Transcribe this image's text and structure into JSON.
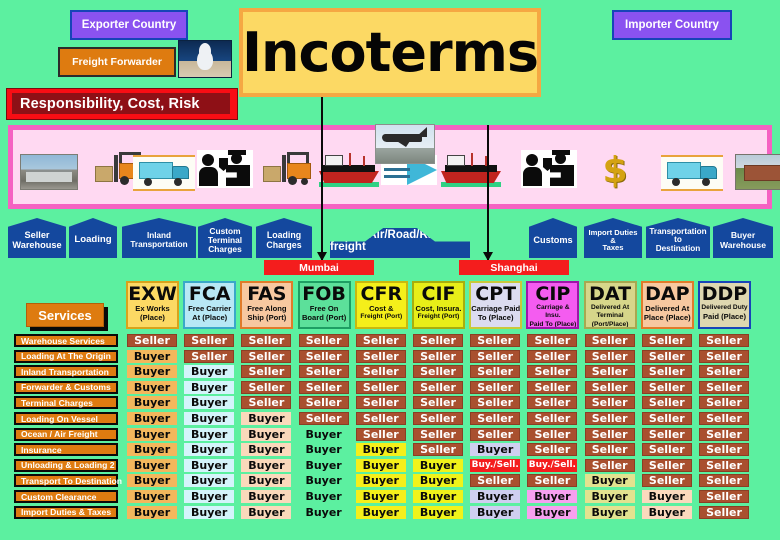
{
  "title": "Incoterms",
  "labels": {
    "exporter_country": "Exporter Country",
    "importer_country": "Importer Country",
    "freight_forwarder": "Freight Forwarder",
    "responsibility": "Responsibility, Cost, Risk",
    "services_title": "Services",
    "freight_band": "Ocean/Air/Road/Rail freight"
  },
  "ports": [
    {
      "name": "Mumbai"
    },
    {
      "name": "Shanghai"
    }
  ],
  "stages": [
    {
      "label": "Seller Warehouse",
      "lines": [
        "Seller",
        "Warehouse"
      ]
    },
    {
      "label": "Loading",
      "lines": [
        "Loading"
      ]
    },
    {
      "label": "Inland Transportation",
      "lines": [
        "Inland",
        "Transportation"
      ]
    },
    {
      "label": "Custom Terminal Charges",
      "lines": [
        "Custom",
        "Terminal",
        "Charges"
      ]
    },
    {
      "label": "Loading Charges",
      "lines": [
        "Loading",
        "Charges"
      ]
    },
    {
      "label": "Customs",
      "lines": [
        "Customs"
      ]
    },
    {
      "label": "Import Duties & Taxes",
      "lines": [
        "Import Duties",
        "&",
        "Taxes"
      ]
    },
    {
      "label": "Transportation to Destination",
      "lines": [
        "Transportation",
        "to",
        "Destination"
      ]
    },
    {
      "label": "Buyer Warehouse",
      "lines": [
        "Buyer",
        "Warehouse"
      ]
    }
  ],
  "icons": [
    "warehouse-photo-icon",
    "forklift-icon",
    "container-truck-icon",
    "customs-officer-icon",
    "forklift-icon",
    "cargo-ship-icon",
    "freight-arrows-icon",
    "airplane-icon",
    "cargo-ship-icon",
    "customs-officer-icon",
    "dollar-sign-icon",
    "container-truck-icon",
    "buyer-warehouse-photo-icon"
  ],
  "services": [
    "Warehouse Services",
    "Loading At The Origin",
    "Inland Transportation",
    "Forwarder & Customs",
    "Terminal Charges",
    "Loading On Vessel",
    "Ocean / Air Freight",
    "Insurance",
    "Unloading & Loading 2",
    "Transport To Destination",
    "Custom Clearance",
    "Import Duties & Taxes"
  ],
  "terms": [
    {
      "code": "EXW",
      "sub": [
        "Ex Works",
        "(Place)"
      ],
      "bg": "#fcd964",
      "border": "#d8a31c",
      "cell_bg": "#f3b75c"
    },
    {
      "code": "FCA",
      "sub": [
        "Free Carrier",
        "At (Place)"
      ],
      "bg": "#b8e8f5",
      "border": "#3aa8c8",
      "cell_bg": "#d4f4fb"
    },
    {
      "code": "FAS",
      "sub": [
        "Free Along",
        "Ship  (Port)"
      ],
      "bg": "#f7c8a0",
      "border": "#e07b2a",
      "cell_bg": "#fad9bb"
    },
    {
      "code": "FOB",
      "sub": [
        "Free On",
        "Board (Port)"
      ],
      "bg": "#5ce09a",
      "border": "#1e9e63",
      "cell_bg": "#5cf0a0"
    },
    {
      "code": "CFR",
      "sub": [
        "Cost &",
        "Freight (Port)"
      ],
      "bg": "#f5ef1a",
      "border": "#c9b80f",
      "cell_bg": "#f5ef1a"
    },
    {
      "code": "CIF",
      "sub": [
        "Cost, Insura.",
        "Freight (Port)"
      ],
      "bg": "#e8ee18",
      "border": "#a8ae0d",
      "cell_bg": "#f0f31a"
    },
    {
      "code": "CPT",
      "sub": [
        "Carriage Paid",
        "To (Place)"
      ],
      "bg": "#dcdcf0",
      "border": "#c9c93a",
      "cell_bg": "#cfcff0"
    },
    {
      "code": "CIP",
      "sub": [
        "Carriage & Insu.",
        "Paid To (Place)"
      ],
      "bg": "#f45cf0",
      "border": "#a015a8",
      "cell_bg": "#f7a0ef"
    },
    {
      "code": "DAT",
      "sub": [
        "Delivered At",
        "Terminal",
        "(Port/Place)"
      ],
      "bg": "#d6d68a",
      "border": "#a8a850",
      "cell_bg": "#e2e28f"
    },
    {
      "code": "DAP",
      "sub": [
        "Delivered At",
        "Place (Place)"
      ],
      "bg": "#f7c8a0",
      "border": "#e07b2a",
      "cell_bg": "#fbd9bd"
    },
    {
      "code": "DDP",
      "sub": [
        "Delivered Duty",
        "Paid (Place)"
      ],
      "bg": "#ded7b0",
      "border": "#1744b8",
      "cell_bg": "#ddd5ae"
    }
  ],
  "matrix": {
    "row_labels": [
      "Warehouse Services",
      "Loading At The Origin",
      "Inland Transportation",
      "Forwarder & Customs",
      "Terminal Charges",
      "Loading On Vessel",
      "Ocean / Air Freight",
      "Insurance",
      "Unloading & Loading 2",
      "Transport To Destination",
      "Custom Clearance",
      "Import Duties & Taxes"
    ],
    "columns": [
      {
        "code": "EXW",
        "values": [
          "Seller",
          "Buyer",
          "Buyer",
          "Buyer",
          "Buyer",
          "Buyer",
          "Buyer",
          "Buyer",
          "Buyer",
          "Buyer",
          "Buyer",
          "Buyer"
        ]
      },
      {
        "code": "FCA",
        "values": [
          "Seller",
          "Seller",
          "Buyer",
          "Buyer",
          "Buyer",
          "Buyer",
          "Buyer",
          "Buyer",
          "Buyer",
          "Buyer",
          "Buyer",
          "Buyer"
        ]
      },
      {
        "code": "FAS",
        "values": [
          "Seller",
          "Seller",
          "Seller",
          "Seller",
          "Seller",
          "Buyer",
          "Buyer",
          "Buyer",
          "Buyer",
          "Buyer",
          "Buyer",
          "Buyer"
        ]
      },
      {
        "code": "FOB",
        "values": [
          "Seller",
          "Seller",
          "Seller",
          "Seller",
          "Seller",
          "Seller",
          "Buyer",
          "Buyer",
          "Buyer",
          "Buyer",
          "Buyer",
          "Buyer"
        ]
      },
      {
        "code": "CFR",
        "values": [
          "Seller",
          "Seller",
          "Seller",
          "Seller",
          "Seller",
          "Seller",
          "Seller",
          "Buyer",
          "Buyer",
          "Buyer",
          "Buyer",
          "Buyer"
        ]
      },
      {
        "code": "CIF",
        "values": [
          "Seller",
          "Seller",
          "Seller",
          "Seller",
          "Seller",
          "Seller",
          "Seller",
          "Seller",
          "Buyer",
          "Buyer",
          "Buyer",
          "Buyer"
        ]
      },
      {
        "code": "CPT",
        "values": [
          "Seller",
          "Seller",
          "Seller",
          "Seller",
          "Seller",
          "Seller",
          "Seller",
          "Buyer",
          "Buy./Sell.",
          "Seller",
          "Buyer",
          "Buyer"
        ]
      },
      {
        "code": "CIP",
        "values": [
          "Seller",
          "Seller",
          "Seller",
          "Seller",
          "Seller",
          "Seller",
          "Seller",
          "Seller",
          "Buy./Sell.",
          "Seller",
          "Buyer",
          "Buyer"
        ]
      },
      {
        "code": "DAT",
        "values": [
          "Seller",
          "Seller",
          "Seller",
          "Seller",
          "Seller",
          "Seller",
          "Seller",
          "Seller",
          "Seller",
          "Buyer",
          "Buyer",
          "Buyer"
        ]
      },
      {
        "code": "DAP",
        "values": [
          "Seller",
          "Seller",
          "Seller",
          "Seller",
          "Seller",
          "Seller",
          "Seller",
          "Seller",
          "Seller",
          "Seller",
          "Buyer",
          "Buyer"
        ]
      },
      {
        "code": "DDP",
        "values": [
          "Seller",
          "Seller",
          "Seller",
          "Seller",
          "Seller",
          "Seller",
          "Seller",
          "Seller",
          "Seller",
          "Seller",
          "Seller",
          "Seller"
        ]
      }
    ]
  },
  "colors": {
    "background": "#5cf0a0",
    "seller": "#a9502f",
    "both": "#f41d1d",
    "chevron": "#14489e",
    "port": "#f41d1d",
    "band": "#ffd9f2",
    "band_border": "#f562c2",
    "service": "#de7b10",
    "title_bg": "#fcd964"
  }
}
